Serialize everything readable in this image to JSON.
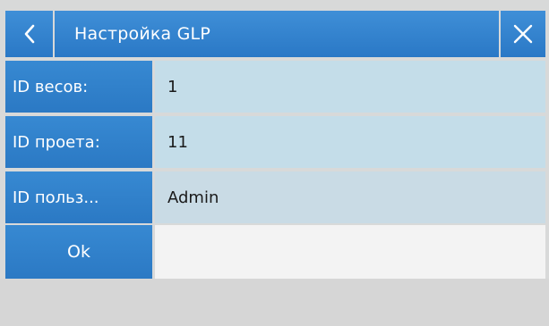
{
  "header": {
    "title": "Настройка GLP",
    "back_icon": "chevron-left-icon",
    "close_icon": "close-icon"
  },
  "fields": [
    {
      "label": "ID весов:",
      "value": "1"
    },
    {
      "label": "ID проета:",
      "value": "11"
    },
    {
      "label": "ID польз...",
      "value": "Admin"
    }
  ],
  "actions": {
    "ok_label": "Ok"
  },
  "colors": {
    "accent_blue": "#2f80cc",
    "value_bg": "#c4dde9",
    "screen_bg": "#d8d9d9"
  }
}
